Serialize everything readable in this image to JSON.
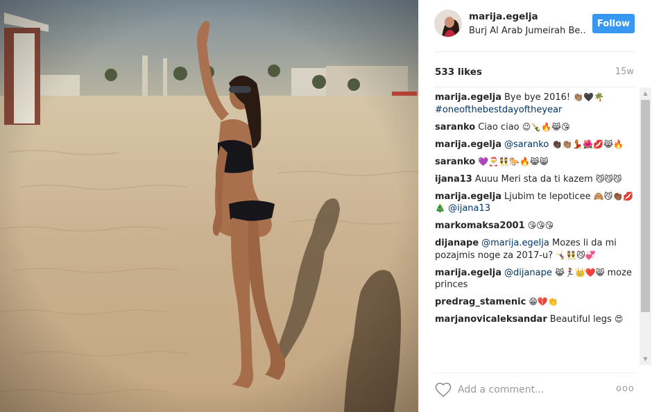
{
  "post": {
    "username": "marija.egelja",
    "location": "Burj Al Arab Jumeirah Be..",
    "follow_label": "Follow",
    "likes": "533 likes",
    "time": "15w"
  },
  "comments": [
    {
      "user": "marija.egelja",
      "text": "Bye bye 2016! ",
      "emoji": "👏🏽🖤🌴",
      "tag": "#oneofthebestdayoftheyear",
      "tag_newline": true
    },
    {
      "user": "saranko",
      "text": "Ciao ciao ",
      "emoji": "😉🍾🔥😹😘"
    },
    {
      "user": "marija.egelja",
      "text": "",
      "tag": "@saranko",
      "emoji": "👏🏿👏🏽💃🌺💋😹🔥"
    },
    {
      "user": "saranko",
      "text": "",
      "emoji": "💜🎅👯🐎🔥😹😸"
    },
    {
      "user": "ijana13",
      "text": "Auuu Meri sta da ti kazem ",
      "emoji": "😼😼😼"
    },
    {
      "user": "marija.egelja",
      "text": "Ljubim te lepoticee ",
      "emoji": "🙈😼👏🏾💋🎄",
      "tag_after": "@ijana13"
    },
    {
      "user": "markomaksa2001",
      "text": "",
      "emoji": "😘😘😘"
    },
    {
      "user": "dijanape",
      "text": "",
      "tag": "@marija.egelja",
      "text_after": " Mozes li da mi pozajmis noge za 2017-u? ",
      "emoji": "🤸‍♀️👯😼💞"
    },
    {
      "user": "marija.egelja",
      "text": "",
      "tag": "@dijanape",
      "emoji": "😹🏃‍♀️👑❤️😸",
      "text_after": " moze princes"
    },
    {
      "user": "predrag_stamenic",
      "text": "",
      "emoji": "😁💔👏"
    },
    {
      "user": "marjanovicaleksandar",
      "text": "Beautiful legs ",
      "emoji": "😍"
    }
  ],
  "comment_input": {
    "placeholder": "Add a comment..."
  },
  "icons": {
    "heart": "heart-outline-icon",
    "more": "more-options-icon"
  },
  "more_label": "ooo"
}
